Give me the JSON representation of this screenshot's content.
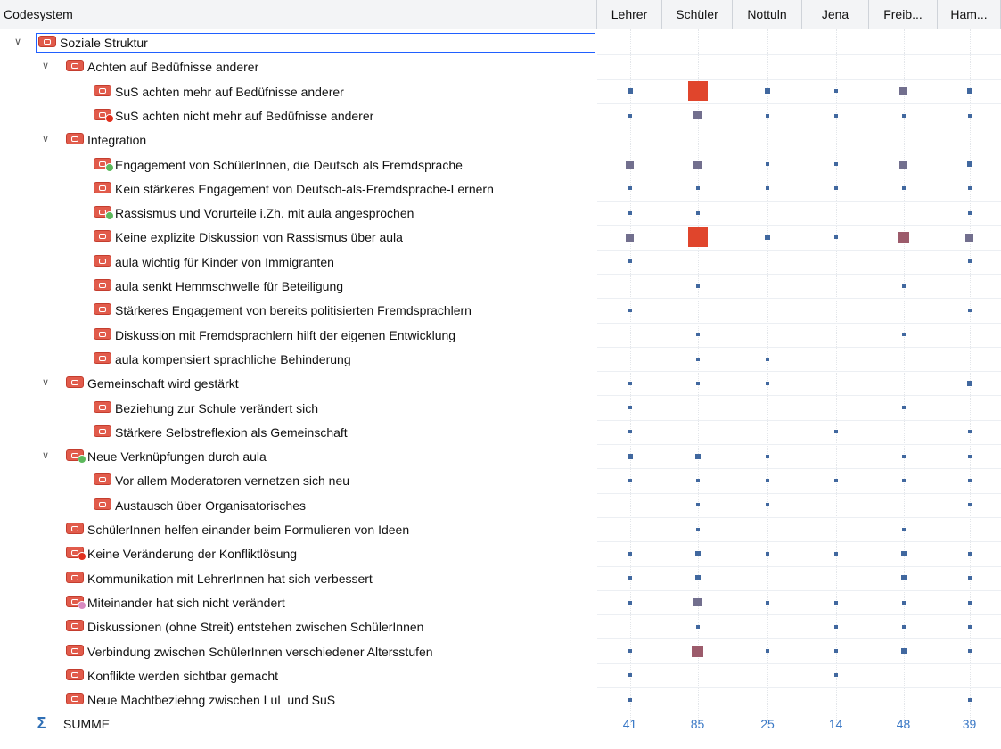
{
  "header": {
    "title": "Codesystem",
    "columns": [
      "Lehrer",
      "Schüler",
      "Nottuln",
      "Jena",
      "Freib...",
      "Ham..."
    ]
  },
  "colors": {
    "code": "#e15b4b",
    "marker_small": "#41689f",
    "marker_mid": "#726f8e",
    "marker_big": "#e0452c",
    "marker_large_mid": "#9c5b6b",
    "sum_text": "#3b79c6",
    "memo_green": "#5cb85c",
    "memo_red": "#e0301e",
    "memo_pink": "#d889c0"
  },
  "rows": [
    {
      "label": "Soziale Struktur",
      "level": 0,
      "expanded": true,
      "memo": null,
      "marks": [
        0,
        0,
        0,
        0,
        0,
        0
      ]
    },
    {
      "label": "Achten auf Bedüfnisse anderer",
      "level": 1,
      "expanded": true,
      "memo": null,
      "marks": [
        0,
        0,
        0,
        0,
        0,
        0
      ]
    },
    {
      "label": "SuS achten mehr auf Bedüfnisse anderer",
      "level": 2,
      "memo": null,
      "marks": [
        2,
        4,
        2,
        1,
        3,
        2
      ]
    },
    {
      "label": "SuS achten nicht mehr auf Bedüfnisse anderer",
      "level": 2,
      "memo": "red",
      "marks": [
        1,
        3,
        1,
        1,
        1,
        1
      ]
    },
    {
      "label": "Integration",
      "level": 1,
      "expanded": true,
      "memo": null,
      "marks": [
        0,
        0,
        0,
        0,
        0,
        0
      ]
    },
    {
      "label": "Engagement von SchülerInnen, die Deutsch als Fremdsprache",
      "level": 2,
      "memo": "green",
      "marks": [
        3,
        3,
        1,
        1,
        3,
        2
      ]
    },
    {
      "label": "Kein stärkeres Engagement von Deutsch-als-Fremdsprache-Lernern",
      "level": 2,
      "memo": null,
      "marks": [
        1,
        1,
        1,
        1,
        1,
        1
      ]
    },
    {
      "label": "Rassismus und Vorurteile i.Zh. mit aula angesprochen",
      "level": 2,
      "memo": "green",
      "marks": [
        1,
        1,
        0,
        0,
        0,
        1
      ]
    },
    {
      "label": "Keine explizite Diskussion von Rassismus über aula",
      "level": 2,
      "memo": null,
      "marks": [
        3,
        4,
        2,
        1,
        5,
        3
      ]
    },
    {
      "label": "aula wichtig für Kinder von Immigranten",
      "level": 2,
      "memo": null,
      "marks": [
        1,
        0,
        0,
        0,
        0,
        1
      ]
    },
    {
      "label": "aula senkt Hemmschwelle für Beteiligung",
      "level": 2,
      "memo": null,
      "marks": [
        0,
        1,
        0,
        0,
        1,
        0
      ]
    },
    {
      "label": "Stärkeres Engagement von bereits politisierten Fremdsprachlern",
      "level": 2,
      "memo": null,
      "marks": [
        1,
        0,
        0,
        0,
        0,
        1
      ]
    },
    {
      "label": "Diskussion mit Fremdsprachlern hilft der eigenen Entwicklung",
      "level": 2,
      "memo": null,
      "marks": [
        0,
        1,
        0,
        0,
        1,
        0
      ]
    },
    {
      "label": "aula kompensiert sprachliche Behinderung",
      "level": 2,
      "memo": null,
      "marks": [
        0,
        1,
        1,
        0,
        0,
        0
      ]
    },
    {
      "label": "Gemeinschaft wird gestärkt",
      "level": 1,
      "expanded": true,
      "memo": null,
      "marks": [
        1,
        1,
        1,
        0,
        0,
        2
      ]
    },
    {
      "label": "Beziehung zur Schule verändert sich",
      "level": 2,
      "memo": null,
      "marks": [
        1,
        0,
        0,
        0,
        1,
        0
      ]
    },
    {
      "label": "Stärkere Selbstreflexion als Gemeinschaft",
      "level": 2,
      "memo": null,
      "marks": [
        1,
        0,
        0,
        1,
        0,
        1
      ]
    },
    {
      "label": "Neue Verknüpfungen durch aula",
      "level": 1,
      "expanded": true,
      "memo": "green",
      "marks": [
        2,
        2,
        1,
        0,
        1,
        1
      ]
    },
    {
      "label": "Vor allem Moderatoren vernetzen sich neu",
      "level": 2,
      "memo": null,
      "marks": [
        1,
        1,
        1,
        1,
        1,
        1
      ]
    },
    {
      "label": "Austausch über Organisatorisches",
      "level": 2,
      "memo": null,
      "marks": [
        0,
        1,
        1,
        0,
        0,
        1
      ]
    },
    {
      "label": "SchülerInnen helfen einander beim Formulieren von Ideen",
      "level": 1,
      "memo": null,
      "marks": [
        0,
        1,
        0,
        0,
        1,
        0
      ]
    },
    {
      "label": "Keine Veränderung der Konfliktlösung",
      "level": 1,
      "memo": "red",
      "marks": [
        1,
        2,
        1,
        1,
        2,
        1
      ]
    },
    {
      "label": "Kommunikation mit LehrerInnen hat sich verbessert",
      "level": 1,
      "memo": null,
      "marks": [
        1,
        2,
        0,
        0,
        2,
        1
      ]
    },
    {
      "label": "Miteinander hat sich nicht verändert",
      "level": 1,
      "memo": "pink",
      "marks": [
        1,
        3,
        1,
        1,
        1,
        1
      ]
    },
    {
      "label": "Diskussionen (ohne Streit) entstehen zwischen SchülerInnen",
      "level": 1,
      "memo": null,
      "marks": [
        0,
        1,
        0,
        1,
        1,
        1
      ]
    },
    {
      "label": "Verbindung zwischen SchülerInnen verschiedener Altersstufen",
      "level": 1,
      "memo": null,
      "marks": [
        1,
        5,
        1,
        1,
        2,
        1
      ]
    },
    {
      "label": "Konflikte werden sichtbar gemacht",
      "level": 1,
      "memo": null,
      "marks": [
        1,
        0,
        0,
        1,
        0,
        0
      ]
    },
    {
      "label": "Neue Machtbeziehng zwischen LuL und SuS",
      "level": 1,
      "memo": null,
      "marks": [
        1,
        0,
        0,
        0,
        0,
        1
      ]
    }
  ],
  "summary": {
    "label": "SUMME",
    "icon": "sigma-icon",
    "values": [
      "41",
      "85",
      "25",
      "14",
      "48",
      "39"
    ]
  }
}
